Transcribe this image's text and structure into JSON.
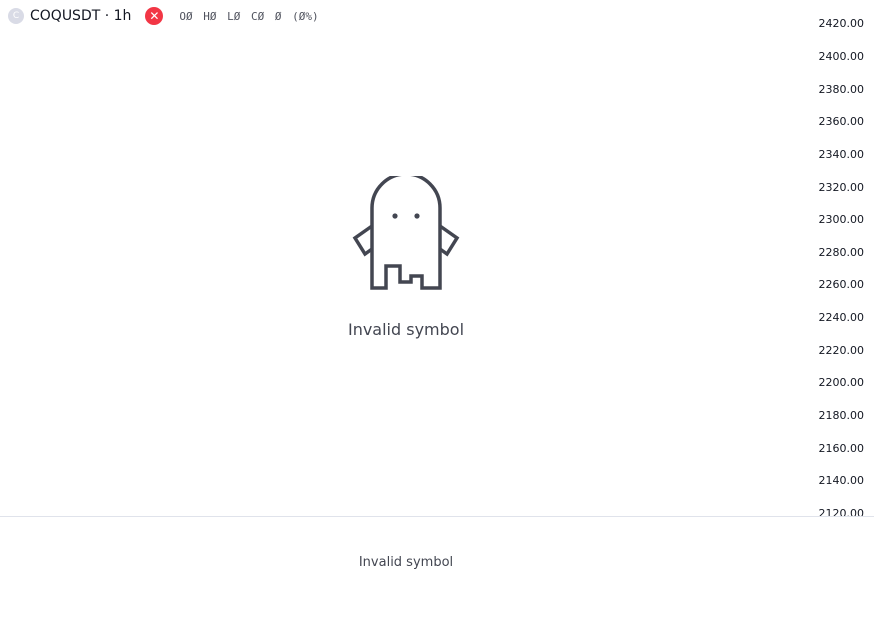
{
  "legend": {
    "logo_letter": "C",
    "symbol_title": "COQUSDT · 1h",
    "error_icon": "close-icon",
    "ohlc": [
      "OØ",
      "HØ",
      "LØ",
      "CØ",
      "Ø",
      "(Ø%)"
    ]
  },
  "price_axis": {
    "ticks": [
      "2420.00",
      "2400.00",
      "2380.00",
      "2360.00",
      "2340.00",
      "2320.00",
      "2300.00",
      "2280.00",
      "2260.00",
      "2240.00",
      "2220.00",
      "2200.00",
      "2180.00",
      "2160.00",
      "2140.00",
      "2120.00"
    ]
  },
  "main_pane": {
    "illustration": "ghost-icon",
    "message": "Invalid symbol"
  },
  "lower_pane": {
    "message": "Invalid symbol"
  },
  "colors": {
    "background": "#ffffff",
    "error": "#f23645",
    "text": "#131722",
    "muted_text": "#434651",
    "separator": "#e0e3eb"
  }
}
